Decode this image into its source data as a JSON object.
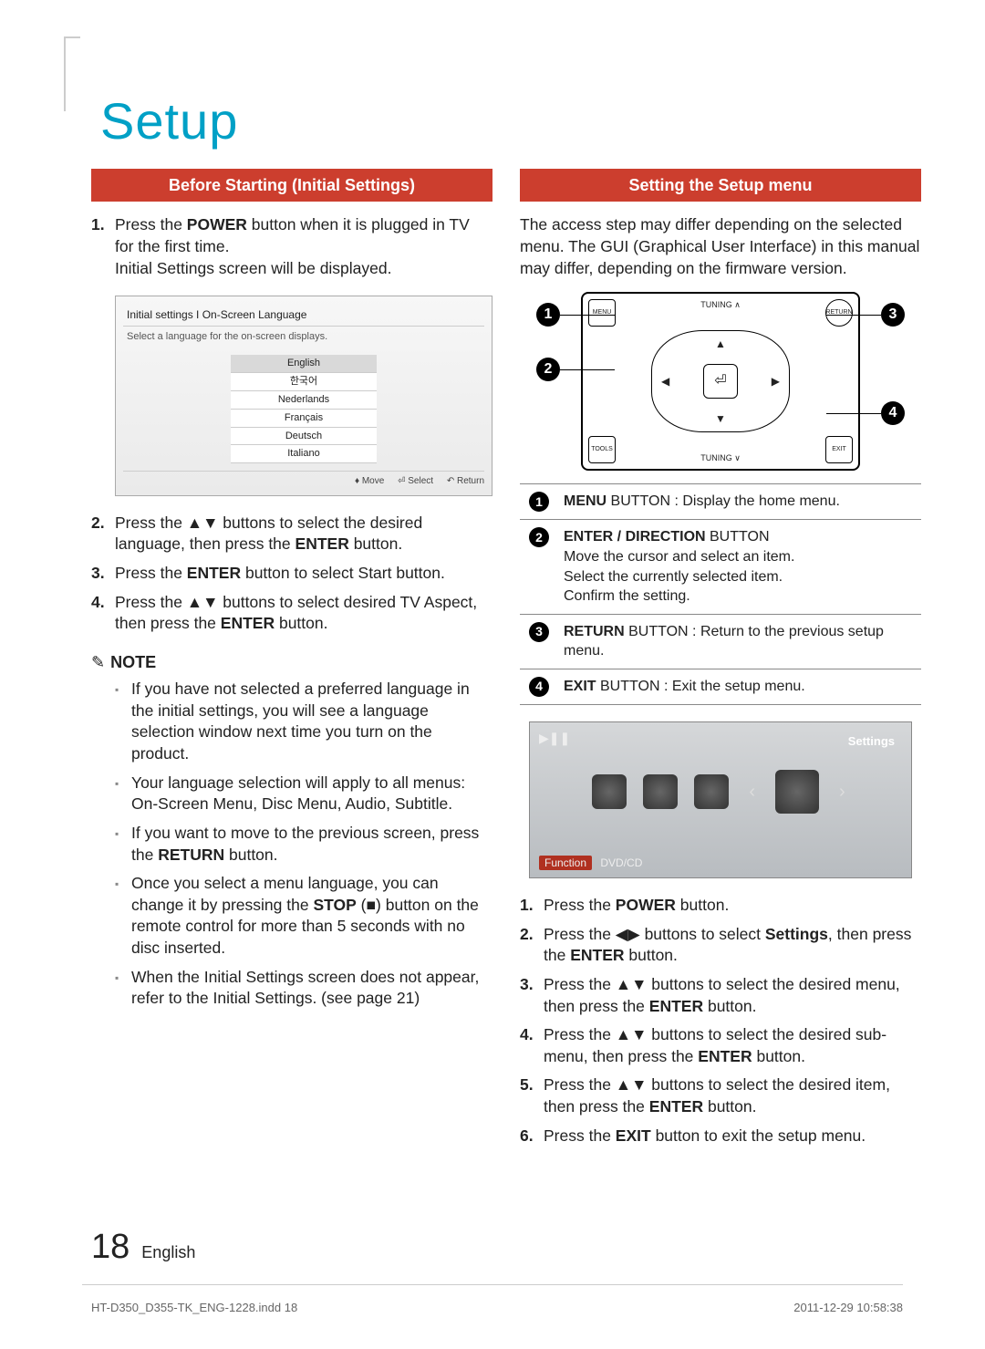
{
  "title": "Setup",
  "leftHead": "Before Starting (Initial Settings)",
  "rightHead": "Setting the Setup menu",
  "leftSteps": [
    "Press the <b>POWER</b> button when it is plugged in TV for the first time.<br>Initial Settings screen will be displayed.",
    "Press the ▲▼ buttons to select the desired language, then press the <b>ENTER</b> button.",
    "Press the <b>ENTER</b> button to select Start button.",
    "Press the ▲▼ buttons to select desired TV Aspect, then press the <b>ENTER</b> button."
  ],
  "screenshot": {
    "title": "Initial settings I On-Screen Language",
    "subtitle": "Select a language for the on-screen displays.",
    "langs": [
      "English",
      "한국어",
      "Nederlands",
      "Français",
      "Deutsch",
      "Italiano"
    ],
    "footMove": "♦ Move",
    "footSelect": "⏎ Select",
    "footReturn": "↶ Return"
  },
  "noteHead": "NOTE",
  "notes": [
    "If you have not selected a preferred language in the initial settings, you will see a language selection window next time you turn on the product.",
    "Your language selection will apply to all menus: On-Screen Menu, Disc Menu, Audio, Subtitle.",
    "If you want to move to the previous screen, press the <b>RETURN</b> button.",
    "Once you select a menu language, you can change it by pressing the <b>STOP</b> (■) button on the remote control for more than 5 seconds with no disc inserted.",
    "When the Initial Settings screen does not appear, refer to the Initial Settings. (see page 21)"
  ],
  "rightIntro": "The access step may differ depending on the selected menu. The GUI (Graphical User Interface) in this manual may differ, depending on the firmware version.",
  "remote": {
    "tuningTop": "TUNING ∧",
    "tuningBottom": "TUNING ∨",
    "menu": "MENU",
    "return": "RETURN",
    "tools": "TOOLS",
    "exit": "EXIT"
  },
  "buttonTable": [
    {
      "n": "1",
      "html": "<b>MENU</b> BUTTON : Display the home menu."
    },
    {
      "n": "2",
      "html": "<b>ENTER / DIRECTION</b> BUTTON<br>Move the cursor and select an item.<br>Select the currently selected item.<br>Confirm the setting."
    },
    {
      "n": "3",
      "html": "<b>RETURN</b> BUTTON : Return to the previous setup menu."
    },
    {
      "n": "4",
      "html": "<b>EXIT</b> BUTTON : Exit the setup menu."
    }
  ],
  "gui": {
    "playpause": "▶❚❚",
    "label": "Settings",
    "fn": "Function",
    "src": "DVD/CD"
  },
  "rightSteps": [
    "Press the <b>POWER</b> button.",
    "Press the ◀▶ buttons to select <b>Settings</b>, then press the <b>ENTER</b> button.",
    "Press the ▲▼ buttons to select the desired menu, then press the <b>ENTER</b> button.",
    "Press the ▲▼ buttons to select the desired sub-menu, then press the <b>ENTER</b> button.",
    "Press the ▲▼ buttons to select the desired item, then press the <b>ENTER</b> button.",
    "Press the <b>EXIT</b> button to exit the setup menu."
  ],
  "pageNum": "18",
  "pageLang": "English",
  "footerLeft": "HT-D350_D355-TK_ENG-1228.indd   18",
  "footerRight": "2011-12-29    10:58:38"
}
